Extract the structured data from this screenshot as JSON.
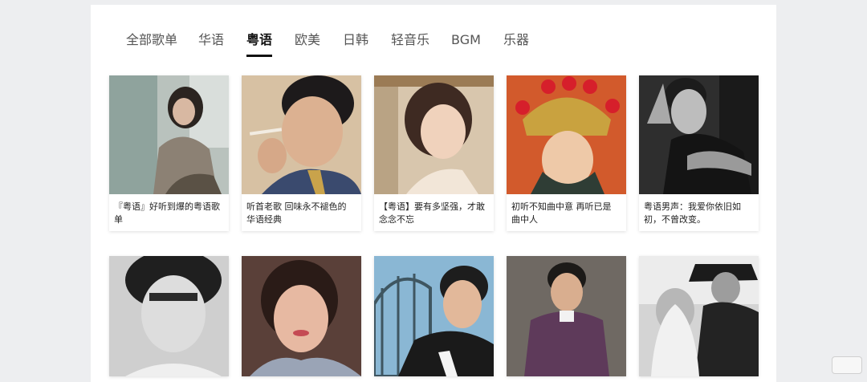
{
  "tabs": [
    {
      "label": "全部歌单",
      "active": false
    },
    {
      "label": "华语",
      "active": false
    },
    {
      "label": "粤语",
      "active": true
    },
    {
      "label": "欧美",
      "active": false
    },
    {
      "label": "日韩",
      "active": false
    },
    {
      "label": "轻音乐",
      "active": false
    },
    {
      "label": "BGM",
      "active": false
    },
    {
      "label": "乐器",
      "active": false
    }
  ],
  "playlists": [
    {
      "title": "『粤语』好听到爆的粤语歌单",
      "cover": "woman-sitting-window-photo"
    },
    {
      "title": "听首老歌 回味永不褪色的华语经典",
      "cover": "man-smoking-portrait-photo"
    },
    {
      "title": "【粤语】要有多坚强，才敢念念不忘",
      "cover": "woman-kitchen-photo"
    },
    {
      "title": "初听不知曲中意 再听已是曲中人",
      "cover": "opera-headdress-woman-photo"
    },
    {
      "title": "粤语男声：我爱你依旧如初，不曾改变。",
      "cover": "man-black-white-photo"
    },
    {
      "title": "",
      "cover": "woman-bangs-bw-photo"
    },
    {
      "title": "",
      "cover": "woman-smiling-photo"
    },
    {
      "title": "",
      "cover": "man-dark-jacket-photo"
    },
    {
      "title": "",
      "cover": "man-purple-sweater-photo"
    },
    {
      "title": "",
      "cover": "couple-bw-photo"
    }
  ]
}
